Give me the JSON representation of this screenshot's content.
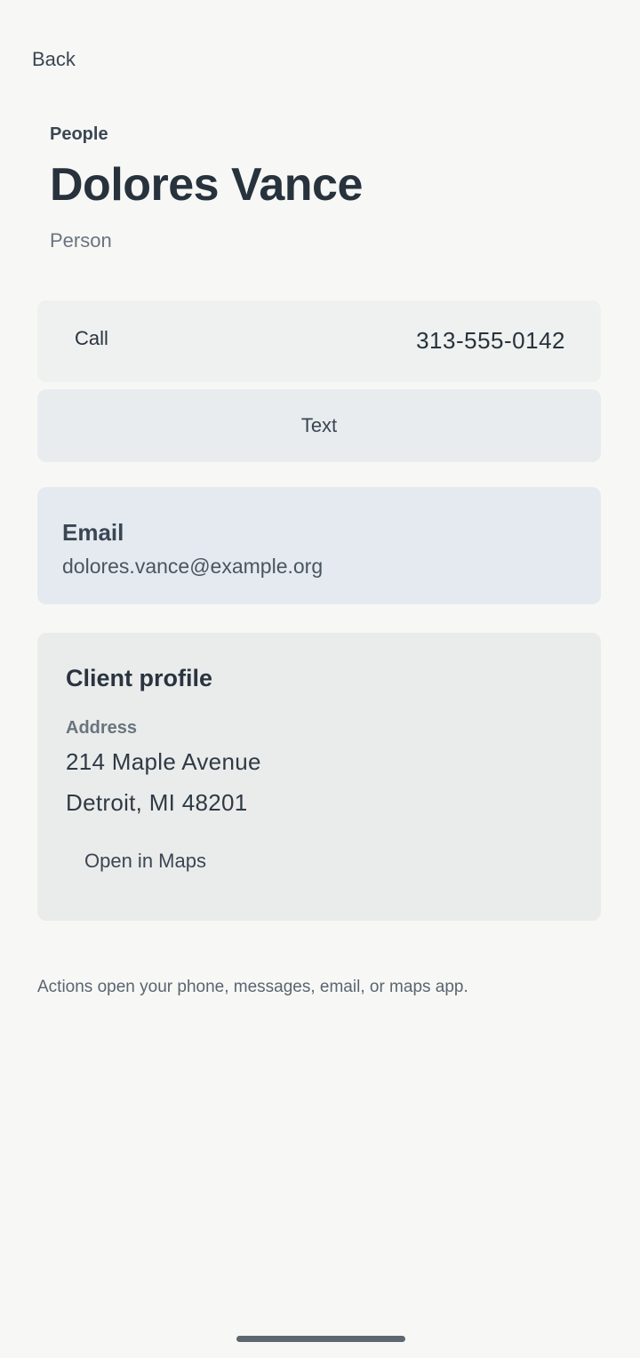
{
  "nav": {
    "back_label": "Back"
  },
  "header": {
    "section_label": "People",
    "name": "Dolores Vance",
    "kind": "Person"
  },
  "call": {
    "label": "Call",
    "number": "313-555-0142"
  },
  "text": {
    "label": "Text"
  },
  "email": {
    "title": "Email",
    "value": "dolores.vance@example.org"
  },
  "profile": {
    "title": "Client profile",
    "address_label": "Address",
    "address_line1": "214 Maple Avenue",
    "address_line2": "Detroit, MI 48201",
    "maps_label": "Open in Maps"
  },
  "footnote": "Actions open your phone, messages, email, or maps app.",
  "colors": {
    "background": "#f7f8f6",
    "call_card": "#eef1ef",
    "text_card": "#e9ecef",
    "email_card": "#e4eaef",
    "profile_card": "#eaeceb",
    "home_indicator": "#5d6770"
  }
}
